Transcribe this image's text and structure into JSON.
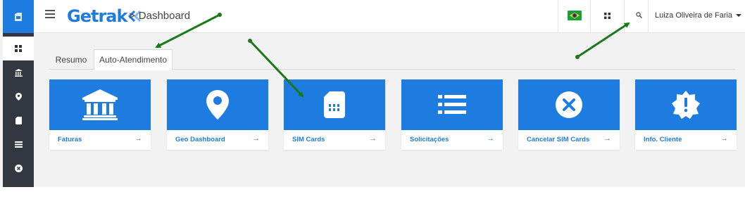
{
  "header": {
    "logo_text": "Getrak",
    "breadcrumb_sep": ">",
    "breadcrumb_page": "Dashboard",
    "user_name": "Luiza Oliveira de Faria"
  },
  "tabs": [
    {
      "label": "Resumo",
      "active": false
    },
    {
      "label": "Auto-Atendimento",
      "active": true
    }
  ],
  "cards": [
    {
      "label": "Faturas",
      "icon": "bank-icon"
    },
    {
      "label": "Geo Dashboard",
      "icon": "map-pin-icon"
    },
    {
      "label": "SIM Cards",
      "icon": "sim-card-icon"
    },
    {
      "label": "Solicitações",
      "icon": "list-icon"
    },
    {
      "label": "Cancelar SIM Cards",
      "icon": "cancel-circle-icon"
    },
    {
      "label": "Info. Cliente",
      "icon": "alert-badge-icon"
    }
  ],
  "card_arrow": "→",
  "sidebar": {
    "items": [
      "dashboard-icon",
      "bank-icon",
      "map-pin-icon",
      "sim-card-icon",
      "list-icon",
      "cancel-circle-icon"
    ]
  },
  "colors": {
    "primary": "#1e7be0",
    "sidebar": "#333740",
    "annotation": "#1a7a1a"
  }
}
